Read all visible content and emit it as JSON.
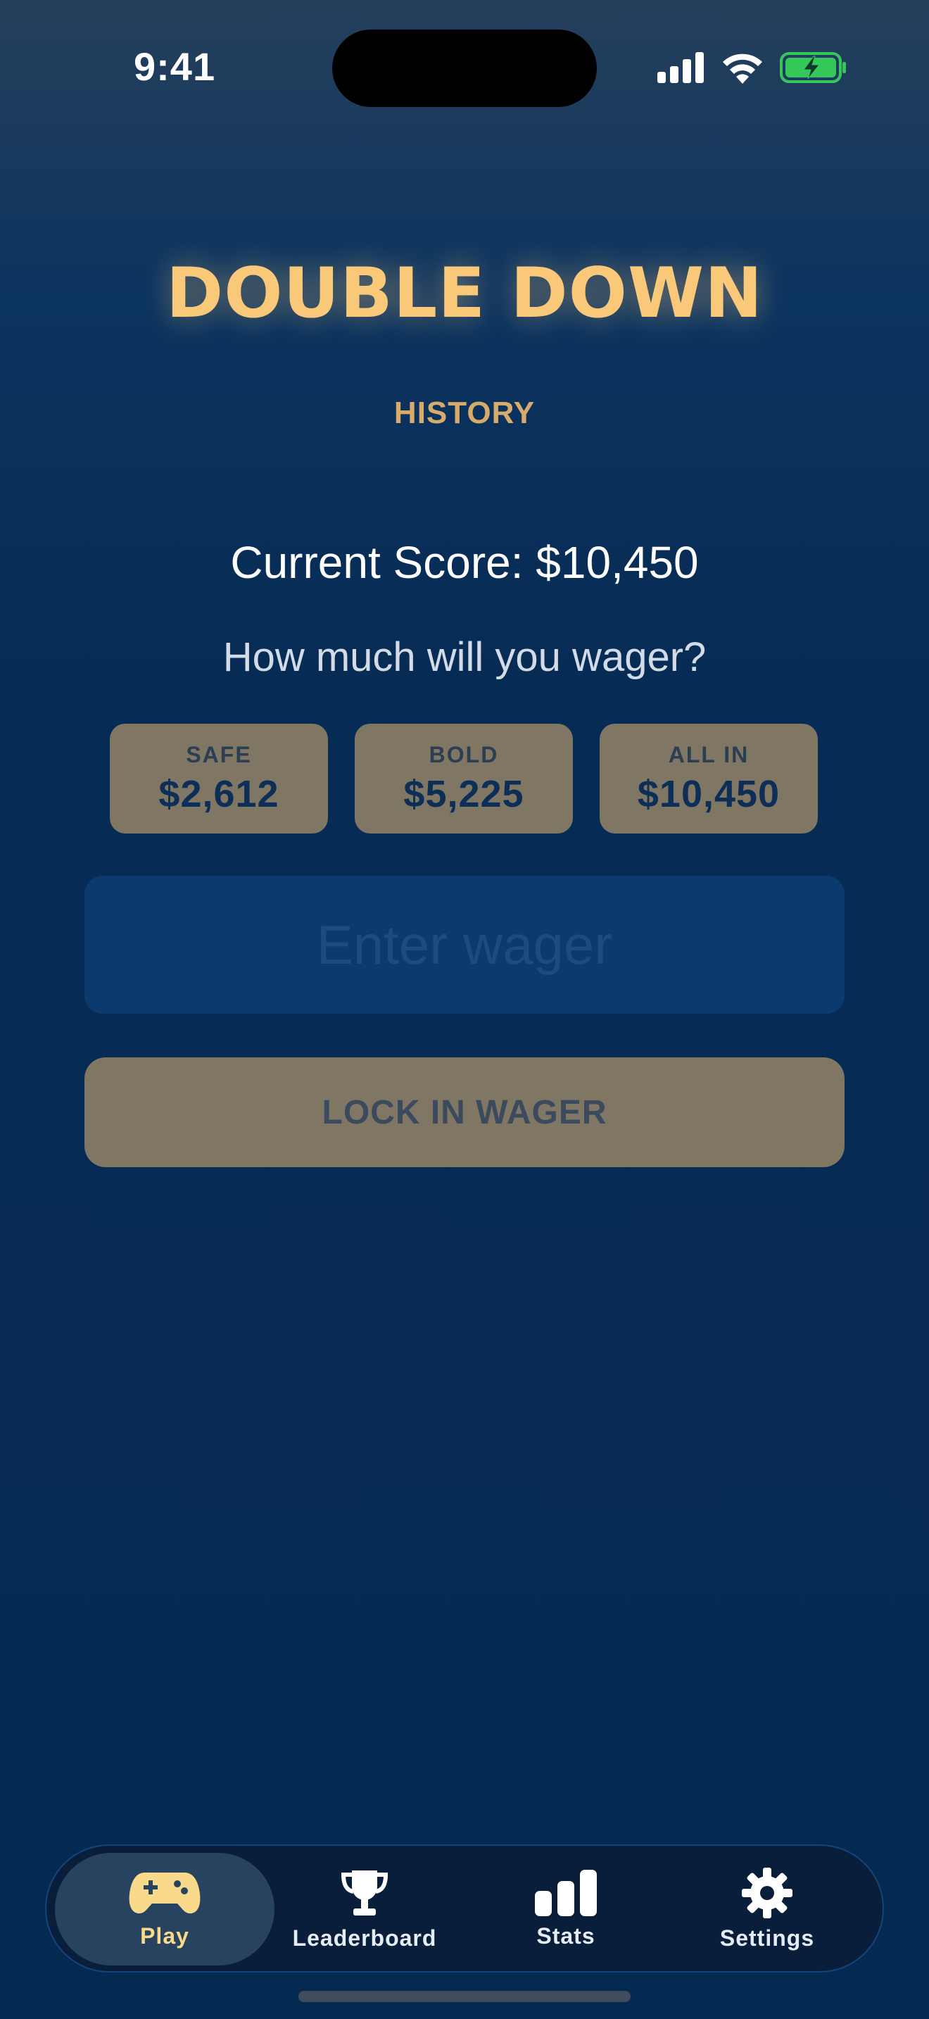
{
  "status_bar": {
    "time": "9:41"
  },
  "game": {
    "title": "DOUBLE DOWN",
    "history_label": "HISTORY",
    "current_score": "Current Score: $10,450",
    "prompt": "How much will you wager?"
  },
  "quick_wagers": [
    {
      "label": "SAFE",
      "value": "$2,612"
    },
    {
      "label": "BOLD",
      "value": "$5,225"
    },
    {
      "label": "ALL IN",
      "value": "$10,450"
    }
  ],
  "wager_input": {
    "placeholder": "Enter wager",
    "value": ""
  },
  "lock_button": {
    "label": "LOCK IN WAGER"
  },
  "tabs": [
    {
      "label": "Play",
      "icon": "gamepad-icon",
      "active": true
    },
    {
      "label": "Leaderboard",
      "icon": "trophy-icon",
      "active": false
    },
    {
      "label": "Stats",
      "icon": "bar-chart-icon",
      "active": false
    },
    {
      "label": "Settings",
      "icon": "gear-icon",
      "active": false
    }
  ],
  "colors": {
    "title": "#f9c878",
    "accent_button": "#7f7663",
    "input_bg": "#0b3a6f",
    "battery": "#34c759"
  }
}
